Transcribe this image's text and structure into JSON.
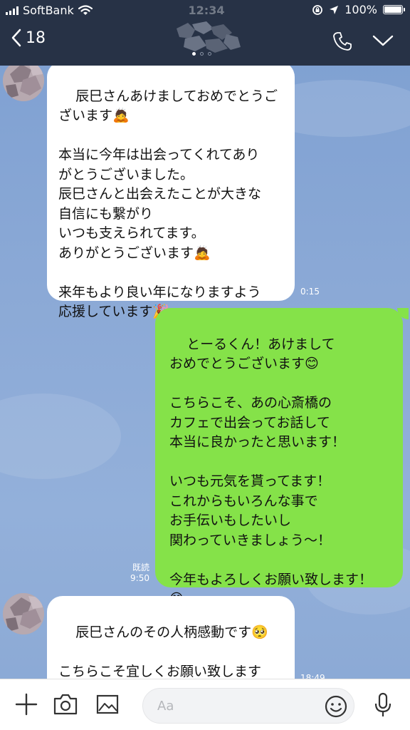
{
  "status_bar": {
    "carrier": "SoftBank",
    "time": "12:34",
    "battery": "100%"
  },
  "header": {
    "back_count": "18",
    "call_icon": "phone-icon",
    "menu_icon": "chevron-down-icon"
  },
  "messages": [
    {
      "side": "in",
      "text": "辰巳さんあけましておめでとうご\nざいます🙇\n\n本当に今年は出会ってくれてあり\nがとうございました。\n辰巳さんと出会えたことが大きな\n自信にも繋がり\nいつも支えられてます。\nありがとうございます🙇\n\n来年もより良い年になりますよう\n応援しています🎉",
      "time": "0:15"
    },
    {
      "side": "out",
      "text": "とーるくん！あけまして\nおめでとうございます😊\n\nこちらこそ、あの心斎橋の\nカフェで出会ってお話して\n本当に良かったと思います！\n\nいつも元気を貰ってます！\nこれからもいろんな事で\nお手伝いもしたいし\n関わっていきましょう〜！\n\n今年もよろしくお願い致します！\n😁",
      "read_label": "既読",
      "time": "9:50"
    },
    {
      "side": "in",
      "text": "辰巳さんのその人柄感動です🥺\n\nこちらこそ宜しくお願い致します\n🙇 🙇",
      "time": "18:49"
    }
  ],
  "input_bar": {
    "placeholder": "Aa",
    "icons": [
      "plus-icon",
      "camera-icon",
      "image-icon",
      "emoji-icon",
      "mic-icon"
    ]
  }
}
